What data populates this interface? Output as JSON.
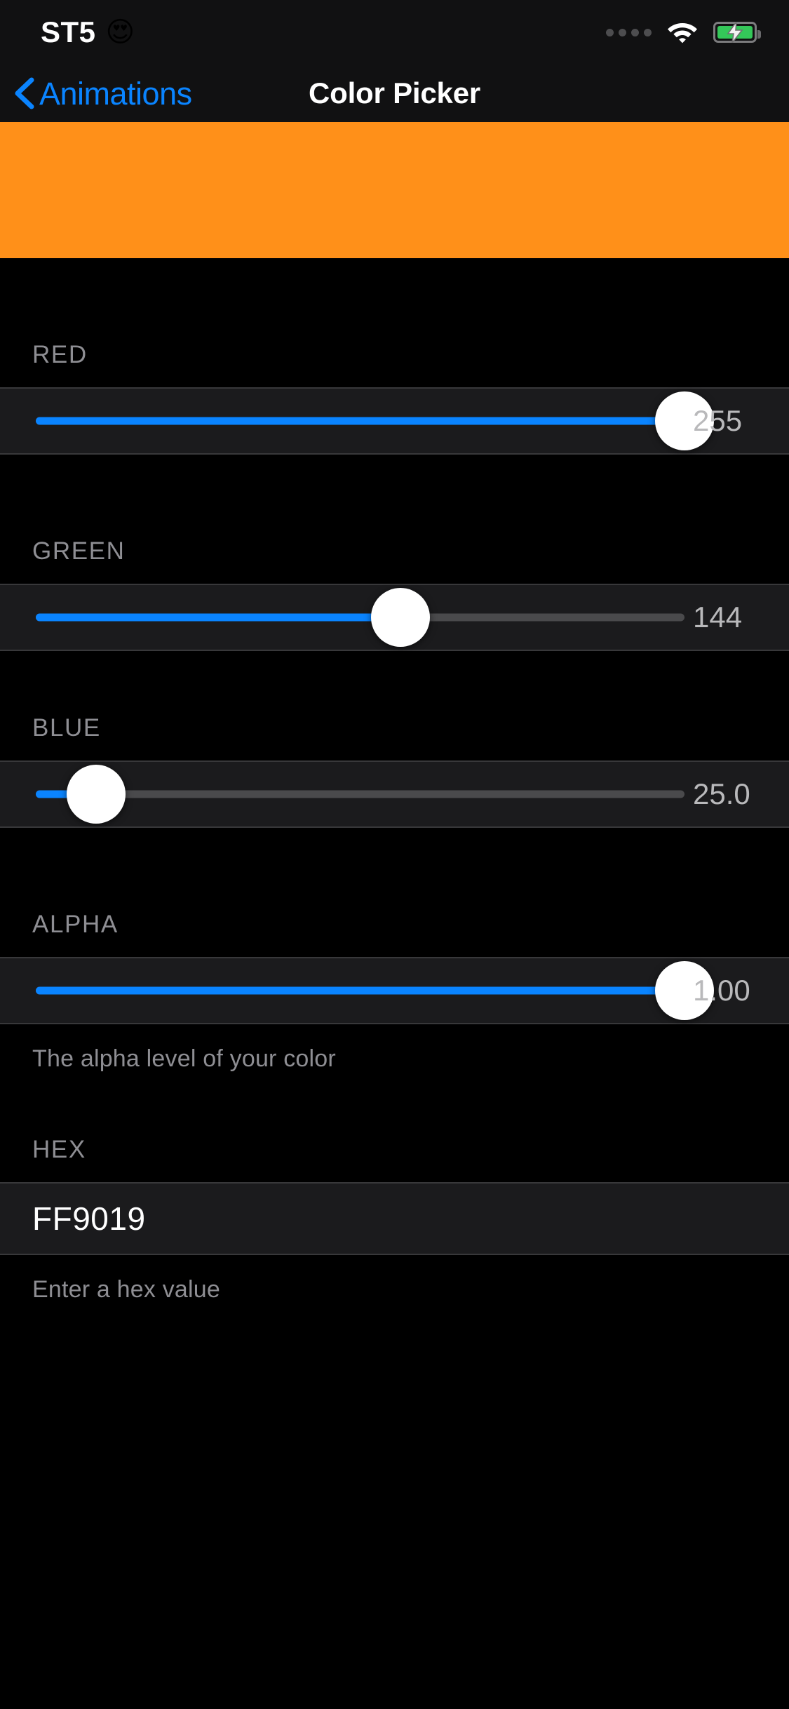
{
  "status_bar": {
    "carrier": "ST5",
    "emoji": "😍",
    "signal_icon": "signal-dots-icon",
    "wifi_icon": "wifi-icon",
    "battery_icon": "battery-charging-icon"
  },
  "nav": {
    "back_icon": "chevron-left-icon",
    "back_label": "Animations",
    "title": "Color Picker"
  },
  "preview": {
    "name": "color-preview-swatch",
    "color": "#FF9019"
  },
  "sections": [
    {
      "id": "red",
      "header": "RED",
      "value_label": "255",
      "fill_percent": 100,
      "thumb_percent": 100
    },
    {
      "id": "green",
      "header": "GREEN",
      "value_label": "144",
      "fill_percent": 56.5,
      "thumb_percent": 56.5
    },
    {
      "id": "blue",
      "header": "BLUE",
      "value_label": "25.0",
      "fill_percent": 9.8,
      "thumb_percent": 9.8
    },
    {
      "id": "alpha",
      "header": "ALPHA",
      "value_label": "1.00",
      "fill_percent": 100,
      "thumb_percent": 100,
      "footer": "The alpha level of your color"
    }
  ],
  "hex": {
    "header": "HEX",
    "value": "FF9019",
    "placeholder": "Enter a hex value",
    "footer": "Enter a hex value"
  },
  "colors": {
    "accent": "#0A84FF",
    "swatch": "#FF9019",
    "track_inactive": "#4A4A4C",
    "label": "#8E8E93",
    "battery_green": "#34C759"
  }
}
